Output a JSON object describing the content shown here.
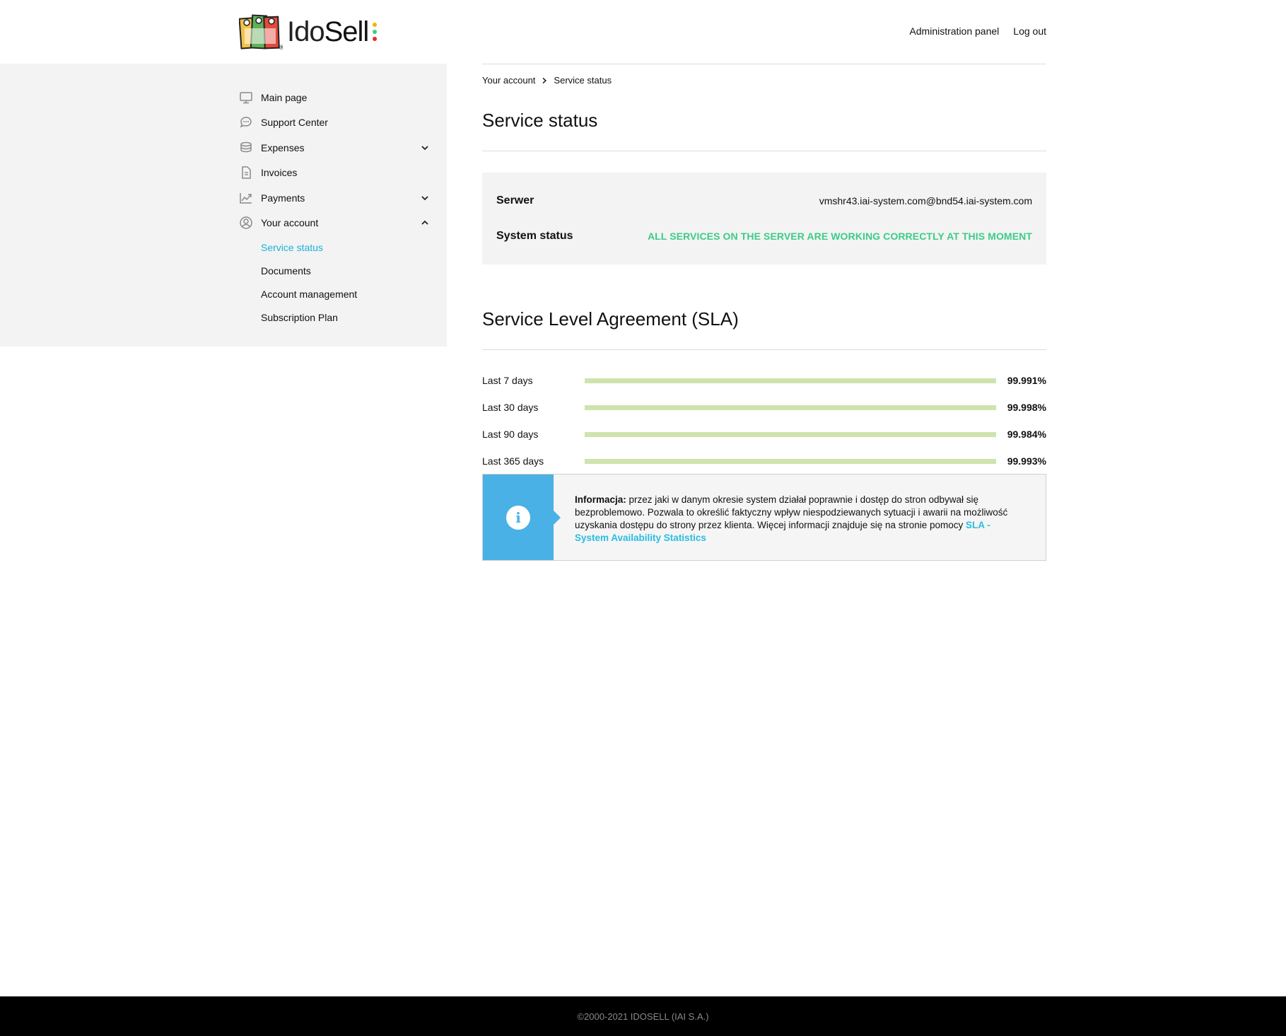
{
  "brand": {
    "logo_text_ido": "Ido",
    "logo_text_sell": "Sell",
    "dot_colors": [
      "#f2b400",
      "#3ccc87",
      "#e0312a"
    ]
  },
  "header": {
    "admin_link": "Administration panel",
    "logout_link": "Log out"
  },
  "sidebar": {
    "items": [
      {
        "label": "Main page",
        "icon": "monitor-icon"
      },
      {
        "label": "Support Center",
        "icon": "chat-bubble-icon"
      },
      {
        "label": "Expenses",
        "icon": "coins-icon",
        "expandable": true,
        "expanded": false
      },
      {
        "label": "Invoices",
        "icon": "document-icon"
      },
      {
        "label": "Payments",
        "icon": "chart-up-icon",
        "expandable": true,
        "expanded": false
      },
      {
        "label": "Your account",
        "icon": "user-circle-icon",
        "expandable": true,
        "expanded": true
      }
    ],
    "subitems": [
      {
        "label": "Service status",
        "active": true
      },
      {
        "label": "Documents"
      },
      {
        "label": "Account management"
      },
      {
        "label": "Subscription Plan"
      }
    ]
  },
  "breadcrumb": {
    "parent": "Your account",
    "current": "Service status"
  },
  "page": {
    "title": "Service status"
  },
  "status": {
    "server_label": "Serwer",
    "server_value": "vmshr43.iai-system.com@bnd54.iai-system.com",
    "system_label": "System status",
    "system_value": "ALL SERVICES ON THE SERVER ARE WORKING CORRECTLY AT THIS MOMENT",
    "ok_color": "#3ccc87"
  },
  "sla": {
    "title": "Service Level Agreement (SLA)",
    "rows": [
      {
        "label": "Last 7 days",
        "value": "99.991%",
        "fraction": 0.99991
      },
      {
        "label": "Last 30 days",
        "value": "99.998%",
        "fraction": 0.99998
      },
      {
        "label": "Last 90 days",
        "value": "99.984%",
        "fraction": 0.99984
      },
      {
        "label": "Last 365 days",
        "value": "99.993%",
        "fraction": 0.99993
      }
    ]
  },
  "info": {
    "lead": "Informacja:",
    "text": " przez jaki w danym okresie system działał poprawnie i dostęp do stron odbywał się bezproblemowo. Pozwala to określić faktyczny wpływ niespodziewanych sytuacji i awarii na możliwość uzyskania dostępu do strony przez klienta. Więcej informacji znajduje się na stronie pomocy ",
    "link": "SLA - System Availability Statistics",
    "icon": "info-icon"
  },
  "footer": {
    "copyright": "©2000-2021 IDOSELL (IAI S.A.)"
  }
}
